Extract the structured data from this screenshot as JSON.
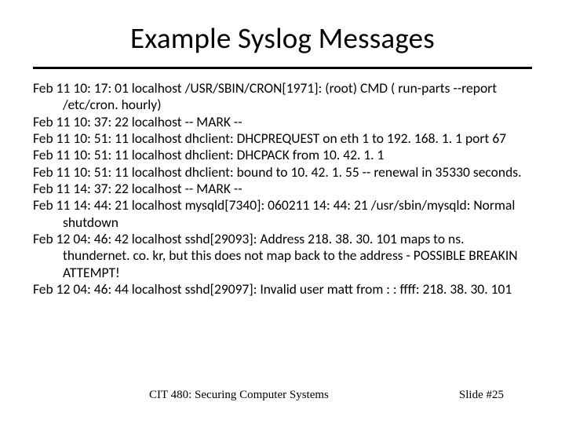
{
  "title": "Example Syslog Messages",
  "log": {
    "e0": "Feb 11 10: 17: 01 localhost /USR/SBIN/CRON[1971]: (root) CMD (   run-parts --report /etc/cron. hourly)",
    "e1": "Feb 11 10: 37: 22 localhost -- MARK --",
    "e2": "Feb 11 10: 51: 11 localhost dhclient: DHCPREQUEST on eth 1 to 192. 168. 1. 1 port 67",
    "e3": "Feb 11 10: 51: 11 localhost dhclient: DHCPACK from 10. 42. 1. 1",
    "e4": "Feb 11 10: 51: 11 localhost dhclient: bound to 10. 42. 1. 55 -- renewal in 35330 seconds.",
    "e5": "Feb 11 14: 37: 22 localhost -- MARK --",
    "e6": "Feb 11 14: 44: 21 localhost mysqld[7340]: 060211 14: 44: 21 /usr/sbin/mysqld: Normal shutdown",
    "e7": "Feb 12 04: 46: 42 localhost sshd[29093]: Address 218. 38. 30. 101 maps to ns. thundernet. co. kr, but this does not map back to the address - POSSIBLE BREAKIN ATTEMPT!",
    "e8": "Feb 12 04: 46: 44 localhost sshd[29097]: Invalid user matt from : : ffff: 218. 38. 30. 101"
  },
  "footer": {
    "left": "CIT 480: Securing Computer Systems",
    "right": "Slide #25"
  }
}
